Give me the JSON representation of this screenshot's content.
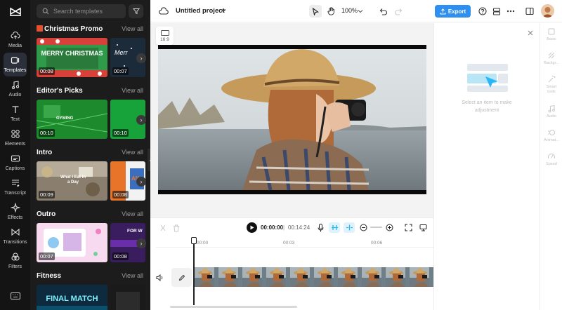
{
  "rail": {
    "items": [
      {
        "label": "Media",
        "icon": "cloud-upload-icon"
      },
      {
        "label": "Templates",
        "icon": "templates-icon"
      },
      {
        "label": "Audio",
        "icon": "music-note-icon"
      },
      {
        "label": "Text",
        "icon": "text-icon"
      },
      {
        "label": "Elements",
        "icon": "elements-icon"
      },
      {
        "label": "Captions",
        "icon": "captions-icon"
      },
      {
        "label": "Transcript",
        "icon": "transcript-icon"
      },
      {
        "label": "Effects",
        "icon": "effects-icon"
      },
      {
        "label": "Transitions",
        "icon": "transitions-icon"
      },
      {
        "label": "Filters",
        "icon": "filters-icon"
      }
    ],
    "active": "Templates"
  },
  "panel": {
    "search_placeholder": "Search templates",
    "view_all": "View all",
    "sections": [
      {
        "title": "Christmas Promo",
        "badge_icon": "gift-icon",
        "thumbs": [
          {
            "duration": "00:08",
            "text": "MERRY CHRISTMAS"
          },
          {
            "duration": "00:07",
            "text": "Merr"
          }
        ]
      },
      {
        "title": "Editor's Picks",
        "thumbs": [
          {
            "duration": "00:10",
            "text": "GYMING"
          },
          {
            "duration": "00:10",
            "text": ""
          }
        ]
      },
      {
        "title": "Intro",
        "thumbs": [
          {
            "duration": "00:09",
            "text": "What I Eat In a Day"
          },
          {
            "duration": "00:08",
            "text": "AN"
          }
        ]
      },
      {
        "title": "Outro",
        "thumbs": [
          {
            "duration": "00:07",
            "text": ""
          },
          {
            "duration": "00:08",
            "text": "FOR W"
          }
        ]
      },
      {
        "title": "Fitness",
        "thumbs": [
          {
            "duration": "",
            "text": "FINAL MATCH"
          },
          {
            "duration": "",
            "text": ""
          }
        ]
      }
    ]
  },
  "topbar": {
    "project_title": "Untitled project",
    "zoom": "100%",
    "export_label": "Export"
  },
  "canvas": {
    "ratio_label": "16:9"
  },
  "props": {
    "hint": "Select an item to make adjustment"
  },
  "side_tabs": [
    "Basic",
    "Backgr...",
    "Smart tools",
    "Audio",
    "Animat...",
    "Speed"
  ],
  "timeline": {
    "current_time": "00:00:00",
    "separator": "|",
    "total_time": "00:14:24",
    "ruler": [
      "00:00",
      "00:03",
      "00:06"
    ]
  },
  "colors": {
    "accent": "#2f8ff0",
    "rail_bg": "#141414",
    "panel_bg": "#1c1c1c",
    "selected_icon": "#29b6f6"
  }
}
